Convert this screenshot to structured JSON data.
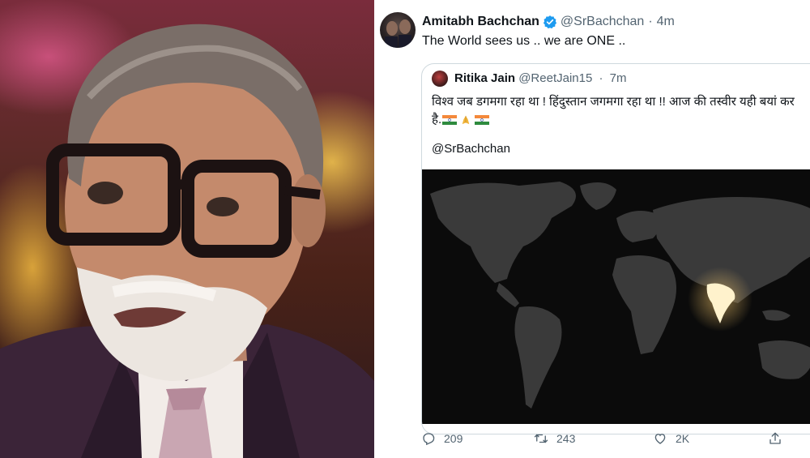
{
  "tweet": {
    "name": "Amitabh Bachchan",
    "handle": "@SrBachchan",
    "separator": "·",
    "time": "4m",
    "text": "The World sees us .. we are ONE ..",
    "verified_icon": "verified-badge-icon",
    "accent_color": "#1d9bf0"
  },
  "quoted": {
    "name": "Ritika Jain",
    "handle": "@ReetJain15",
    "separator": "·",
    "time": "7m",
    "text_line1": "विश्व जब डगमगा रहा था ! हिंदुस्तान जगमगा रहा था !! आज की तस्वीर यही बयां कर",
    "text_line2": "है.",
    "emojis": [
      "indian-flag-icon",
      "folded-hands-icon",
      "indian-flag-icon"
    ],
    "mention": "@SrBachchan",
    "media": "dark-world-map-india-lit"
  },
  "actions": {
    "reply_count": "209",
    "retweet_count": "243",
    "like_count": "2K",
    "reply_icon": "reply-icon",
    "retweet_icon": "retweet-icon",
    "like_icon": "heart-icon",
    "share_icon": "share-icon"
  }
}
